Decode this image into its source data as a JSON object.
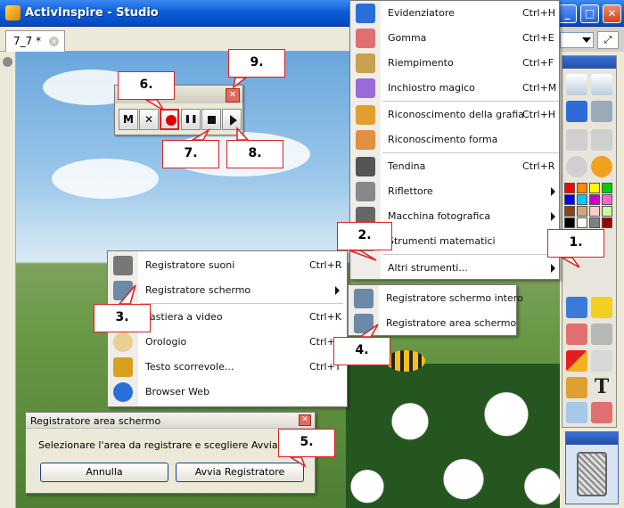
{
  "window": {
    "title": "ActivInspire - Studio",
    "minimize": "_",
    "maximize": "□",
    "close": "✕"
  },
  "tab": {
    "label": "7_7 *",
    "close_glyph": "×"
  },
  "recorder_toolbar": {
    "close_glyph": "✕",
    "buttons": [
      {
        "id": "mute",
        "label": "M"
      },
      {
        "id": "discard",
        "label": "✕"
      },
      {
        "id": "record",
        "label": ""
      },
      {
        "id": "pause",
        "label": "❚❚"
      },
      {
        "id": "stop",
        "label": ""
      },
      {
        "id": "play",
        "label": ""
      }
    ],
    "active_button": "record"
  },
  "tools_menu": {
    "items": [
      {
        "label": "Evidenziatore",
        "shortcut": "Ctrl+H",
        "icon": "highlighter-icon"
      },
      {
        "label": "Gomma",
        "shortcut": "Ctrl+E",
        "icon": "eraser-icon"
      },
      {
        "label": "Riempimento",
        "shortcut": "Ctrl+F",
        "icon": "fill-bucket-icon"
      },
      {
        "label": "Inchiostro magico",
        "shortcut": "Ctrl+M",
        "icon": "magic-ink-icon"
      },
      {
        "label": "Riconoscimento della grafia",
        "shortcut": "Ctrl+H",
        "icon": "handwriting-icon"
      },
      {
        "label": "Riconoscimento forma",
        "shortcut": "",
        "icon": "shape-recognition-icon"
      },
      {
        "label": "Tendina",
        "shortcut": "Ctrl+R",
        "icon": "revealer-icon"
      },
      {
        "label": "Riflettore",
        "shortcut": "",
        "icon": "spotlight-icon",
        "submenu": true
      },
      {
        "label": "Macchina fotografica",
        "shortcut": "",
        "icon": "camera-icon",
        "submenu": true
      },
      {
        "label": "Strumenti matematici",
        "shortcut": "",
        "icon": "math-tools-icon"
      },
      {
        "label": "Altri strumenti...",
        "shortcut": "",
        "icon": "",
        "submenu": true
      }
    ]
  },
  "more_tools_menu": {
    "items": [
      {
        "label": "Registratore suoni",
        "shortcut": "Ctrl+R",
        "icon": "microphone-icon"
      },
      {
        "label": "Registratore schermo",
        "shortcut": "",
        "icon": "screen-recorder-icon",
        "submenu": true
      },
      {
        "label": "Tastiera a video",
        "shortcut": "Ctrl+K",
        "icon": "keyboard-icon"
      },
      {
        "label": "Orologio",
        "shortcut": "Ctrl+L",
        "icon": "clock-icon"
      },
      {
        "label": "Testo scorrevole...",
        "shortcut": "Ctrl+T",
        "icon": "ticker-icon"
      },
      {
        "label": "Browser Web",
        "shortcut": "",
        "icon": "globe-icon"
      }
    ]
  },
  "screen_recorder_submenu": {
    "items": [
      {
        "label": "Registratore schermo intero",
        "icon": "full-screen-recorder-icon"
      },
      {
        "label": "Registratore area schermo",
        "icon": "area-recorder-icon"
      }
    ]
  },
  "dialog": {
    "title": "Registratore area schermo",
    "close_glyph": "✕",
    "message": "Selezionare l'area da registrare e scegliere Avvia Registratore",
    "cancel_label": "Annulla",
    "start_label": "Avvia Registratore"
  },
  "callouts": [
    "1.",
    "2.",
    "3.",
    "4.",
    "5.",
    "6.",
    "7.",
    "8.",
    "9."
  ],
  "colors": {
    "accent_red": "#e02020",
    "titlebar_blue": "#0a5ed8",
    "palette": [
      "#ff0000",
      "#ff8800",
      "#ffff00",
      "#00cc00",
      "#0000ff",
      "#00ccff",
      "#cc00cc",
      "#ff66cc",
      "#8b4513",
      "#d2a679",
      "#ffcccc",
      "#ccff99",
      "#000000",
      "#ffffff",
      "#808080",
      "#990000"
    ]
  }
}
